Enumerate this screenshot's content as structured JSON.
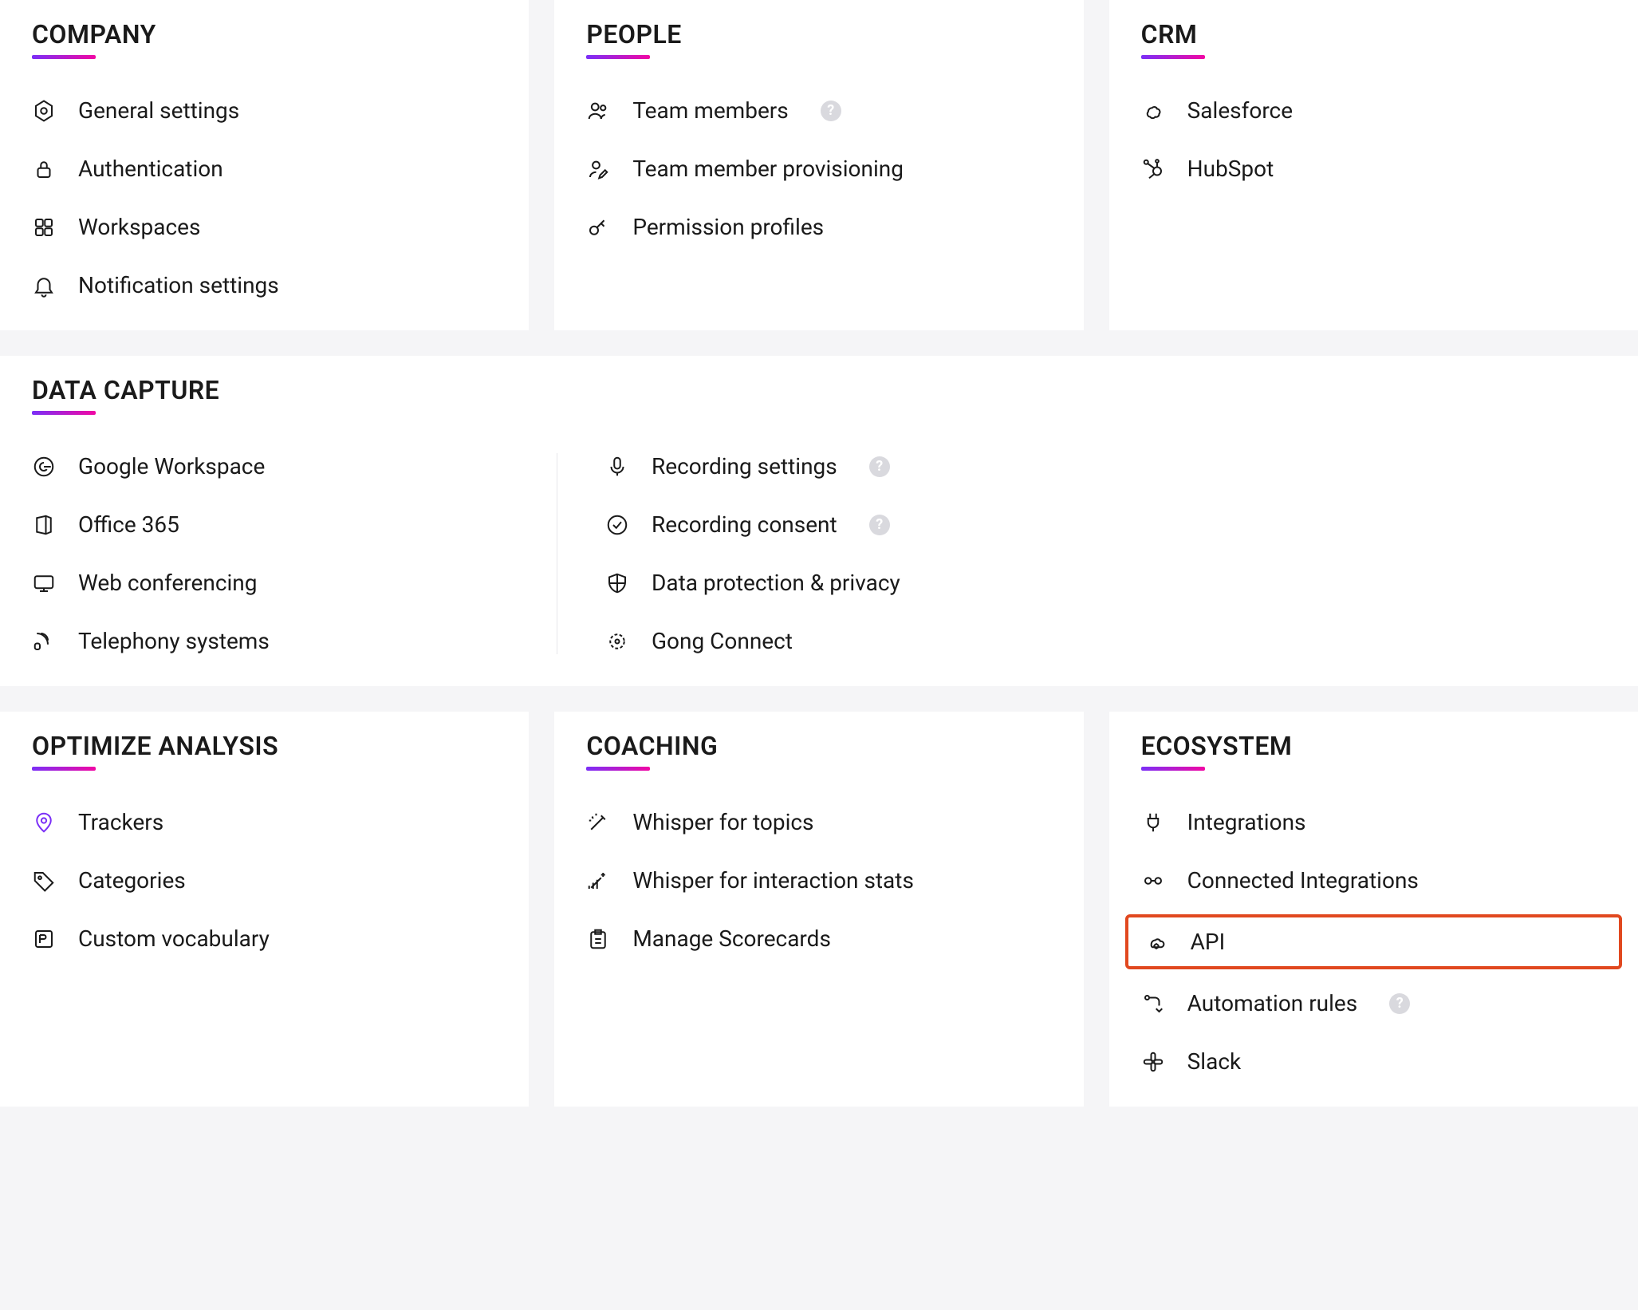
{
  "sections": {
    "company": {
      "title": "COMPANY",
      "items": [
        {
          "icon": "settings-hex-icon",
          "label": "General settings"
        },
        {
          "icon": "lock-icon",
          "label": "Authentication"
        },
        {
          "icon": "grid-icon",
          "label": "Workspaces"
        },
        {
          "icon": "bell-icon",
          "label": "Notification settings"
        }
      ]
    },
    "people": {
      "title": "PEOPLE",
      "items": [
        {
          "icon": "users-icon",
          "label": "Team members",
          "help": true
        },
        {
          "icon": "user-edit-icon",
          "label": "Team member provisioning"
        },
        {
          "icon": "key-icon",
          "label": "Permission profiles"
        }
      ]
    },
    "crm": {
      "title": "CRM",
      "items": [
        {
          "icon": "salesforce-icon",
          "label": "Salesforce"
        },
        {
          "icon": "hubspot-icon",
          "label": "HubSpot"
        }
      ]
    },
    "data_capture": {
      "title": "DATA CAPTURE",
      "col1": [
        {
          "icon": "google-icon",
          "label": "Google Workspace"
        },
        {
          "icon": "office-icon",
          "label": "Office 365"
        },
        {
          "icon": "webconf-icon",
          "label": "Web conferencing"
        },
        {
          "icon": "telephony-icon",
          "label": "Telephony systems"
        }
      ],
      "col2": [
        {
          "icon": "mic-icon",
          "label": "Recording settings",
          "help": true
        },
        {
          "icon": "check-circle-icon",
          "label": "Recording consent",
          "help": true
        },
        {
          "icon": "shield-icon",
          "label": "Data protection & privacy"
        },
        {
          "icon": "gong-icon",
          "label": "Gong Connect"
        }
      ]
    },
    "optimize": {
      "title": "OPTIMIZE ANALYSIS",
      "items": [
        {
          "icon": "tracker-icon",
          "label": "Trackers",
          "accent": true
        },
        {
          "icon": "tag-icon",
          "label": "Categories"
        },
        {
          "icon": "vocab-icon",
          "label": "Custom vocabulary"
        }
      ]
    },
    "coaching": {
      "title": "COACHING",
      "items": [
        {
          "icon": "wand-icon",
          "label": "Whisper for topics"
        },
        {
          "icon": "wand-stats-icon",
          "label": "Whisper for interaction stats"
        },
        {
          "icon": "scorecard-icon",
          "label": "Manage Scorecards"
        }
      ]
    },
    "ecosystem": {
      "title": "ECOSYSTEM",
      "items": [
        {
          "icon": "plug-icon",
          "label": "Integrations"
        },
        {
          "icon": "connected-icon",
          "label": "Connected Integrations"
        },
        {
          "icon": "api-icon",
          "label": "API",
          "highlight": true
        },
        {
          "icon": "automation-icon",
          "label": "Automation rules",
          "help": true
        },
        {
          "icon": "slack-icon",
          "label": "Slack"
        }
      ]
    }
  },
  "help_glyph": "?"
}
